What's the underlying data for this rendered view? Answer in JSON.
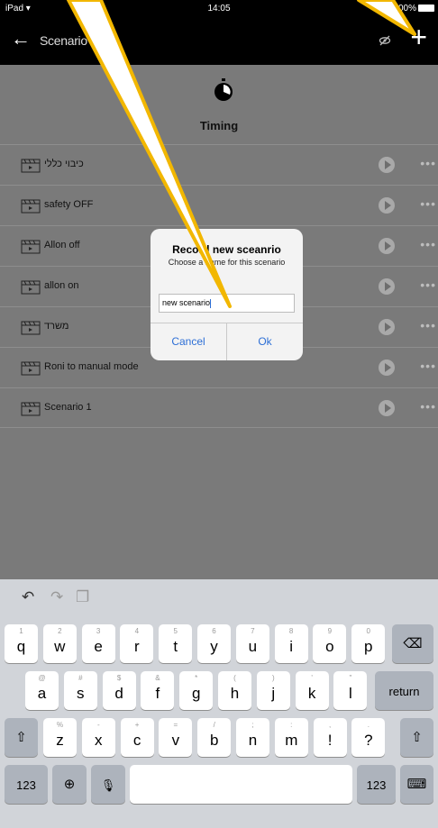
{
  "status_bar": {
    "device": "iPad",
    "time": "14:05",
    "battery": "100%"
  },
  "nav": {
    "title": "Scenario"
  },
  "header": {
    "timing_label": "Timing"
  },
  "scenarios": [
    {
      "label": "כיבוי כללי"
    },
    {
      "label": "safety OFF"
    },
    {
      "label": "Allon off"
    },
    {
      "label": "allon on"
    },
    {
      "label": "משרד"
    },
    {
      "label": "Roni to manual mode"
    },
    {
      "label": "Scenario 1"
    }
  ],
  "dialog": {
    "title": "Record new sceanrio",
    "message": "Choose a name for this scenario",
    "input_value": "new scenario",
    "cancel_label": "Cancel",
    "ok_label": "Ok"
  },
  "keyboard": {
    "row1": [
      {
        "main": "q",
        "sub": "1"
      },
      {
        "main": "w",
        "sub": "2"
      },
      {
        "main": "e",
        "sub": "3"
      },
      {
        "main": "r",
        "sub": "4"
      },
      {
        "main": "t",
        "sub": "5"
      },
      {
        "main": "y",
        "sub": "6"
      },
      {
        "main": "u",
        "sub": "7"
      },
      {
        "main": "i",
        "sub": "8"
      },
      {
        "main": "o",
        "sub": "9"
      },
      {
        "main": "p",
        "sub": "0"
      }
    ],
    "row2": [
      {
        "main": "a",
        "sub": "@"
      },
      {
        "main": "s",
        "sub": "#"
      },
      {
        "main": "d",
        "sub": "$"
      },
      {
        "main": "f",
        "sub": "&"
      },
      {
        "main": "g",
        "sub": "*"
      },
      {
        "main": "h",
        "sub": "("
      },
      {
        "main": "j",
        "sub": ")"
      },
      {
        "main": "k",
        "sub": "'"
      },
      {
        "main": "l",
        "sub": "\""
      }
    ],
    "row3": [
      {
        "main": "z",
        "sub": "%"
      },
      {
        "main": "x",
        "sub": "-"
      },
      {
        "main": "c",
        "sub": "+"
      },
      {
        "main": "v",
        "sub": "="
      },
      {
        "main": "b",
        "sub": "/"
      },
      {
        "main": "n",
        "sub": ";"
      },
      {
        "main": "m",
        "sub": ":"
      },
      {
        "main": "!",
        "sub": ","
      },
      {
        "main": "?",
        "sub": "."
      }
    ],
    "return_label": "return",
    "numbers_label": "123",
    "accent_color": "#2d6fd6",
    "pointer_color": "#f2b700"
  }
}
